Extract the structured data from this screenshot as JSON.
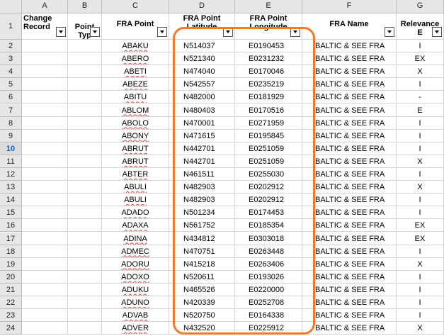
{
  "columns": [
    "A",
    "B",
    "C",
    "D",
    "E",
    "F",
    "G"
  ],
  "header_row_number": "1",
  "headers": [
    {
      "line1": "Change",
      "line2": "Record",
      "align": "left"
    },
    {
      "line1": "Point Typ",
      "line2": "",
      "align": "center"
    },
    {
      "line1": "FRA Point",
      "line2": "",
      "align": "center"
    },
    {
      "line1": "FRA Point",
      "line2": "Latitude",
      "align": "center"
    },
    {
      "line1": "FRA Point",
      "line2": "Longitude",
      "align": "center"
    },
    {
      "line1": "FRA Name",
      "line2": "",
      "align": "center"
    },
    {
      "line1": "Relevance E",
      "line2": "",
      "align": "center"
    }
  ],
  "selected_row": "10",
  "rows": [
    {
      "num": "2",
      "point": "ABAKU",
      "lat": "N514037",
      "lon": "E0190453",
      "name": "BALTIC & SEE FRA",
      "rel": "I"
    },
    {
      "num": "3",
      "point": "ABERO",
      "lat": "N521340",
      "lon": "E0231232",
      "name": "BALTIC & SEE FRA",
      "rel": "EX"
    },
    {
      "num": "4",
      "point": "ABETI",
      "lat": "N474040",
      "lon": "E0170046",
      "name": "BALTIC & SEE FRA",
      "rel": "X"
    },
    {
      "num": "5",
      "point": "ABEZE",
      "lat": "N542557",
      "lon": "E0235219",
      "name": "BALTIC & SEE FRA",
      "rel": "I"
    },
    {
      "num": "6",
      "point": "ABITU",
      "lat": "N482000",
      "lon": "E0181929",
      "name": "BALTIC & SEE FRA",
      "rel": "-"
    },
    {
      "num": "7",
      "point": "ABLOM",
      "lat": "N480403",
      "lon": "E0170516",
      "name": "BALTIC & SEE FRA",
      "rel": "E"
    },
    {
      "num": "8",
      "point": "ABOLO",
      "lat": "N470001",
      "lon": "E0271959",
      "name": "BALTIC & SEE FRA",
      "rel": "I"
    },
    {
      "num": "9",
      "point": "ABONY",
      "lat": "N471615",
      "lon": "E0195845",
      "name": "BALTIC & SEE FRA",
      "rel": "I"
    },
    {
      "num": "10",
      "point": "ABRUT",
      "lat": "N442701",
      "lon": "E0251059",
      "name": "BALTIC & SEE FRA",
      "rel": "I"
    },
    {
      "num": "11",
      "point": "ABRUT",
      "lat": "N442701",
      "lon": "E0251059",
      "name": "BALTIC & SEE FRA",
      "rel": "X"
    },
    {
      "num": "12",
      "point": "ABTER",
      "lat": "N461511",
      "lon": "E0255030",
      "name": "BALTIC & SEE FRA",
      "rel": "I"
    },
    {
      "num": "13",
      "point": "ABULI",
      "lat": "N482903",
      "lon": "E0202912",
      "name": "BALTIC & SEE FRA",
      "rel": "X"
    },
    {
      "num": "14",
      "point": "ABULI",
      "lat": "N482903",
      "lon": "E0202912",
      "name": "BALTIC & SEE FRA",
      "rel": "I"
    },
    {
      "num": "15",
      "point": "ADADO",
      "lat": "N501234",
      "lon": "E0174453",
      "name": "BALTIC & SEE FRA",
      "rel": "I"
    },
    {
      "num": "16",
      "point": "ADAXA",
      "lat": "N561752",
      "lon": "E0185354",
      "name": "BALTIC & SEE FRA",
      "rel": "EX"
    },
    {
      "num": "17",
      "point": "ADINA",
      "lat": "N434812",
      "lon": "E0303018",
      "name": "BALTIC & SEE FRA",
      "rel": "EX"
    },
    {
      "num": "18",
      "point": "ADMEC",
      "lat": "N470751",
      "lon": "E0263448",
      "name": "BALTIC & SEE FRA",
      "rel": "I"
    },
    {
      "num": "19",
      "point": "ADORU",
      "lat": "N415218",
      "lon": "E0263406",
      "name": "BALTIC & SEE FRA",
      "rel": "X"
    },
    {
      "num": "20",
      "point": "ADOXO",
      "lat": "N520611",
      "lon": "E0193026",
      "name": "BALTIC & SEE FRA",
      "rel": "I"
    },
    {
      "num": "21",
      "point": "ADUKU",
      "lat": "N465526",
      "lon": "E0220000",
      "name": "BALTIC & SEE FRA",
      "rel": "I"
    },
    {
      "num": "22",
      "point": "ADUNO",
      "lat": "N420339",
      "lon": "E0252708",
      "name": "BALTIC & SEE FRA",
      "rel": "I"
    },
    {
      "num": "23",
      "point": "ADVAB",
      "lat": "N520750",
      "lon": "E0164338",
      "name": "BALTIC & SEE FRA",
      "rel": "I"
    },
    {
      "num": "24",
      "point": "ADVER",
      "lat": "N432520",
      "lon": "E0225912",
      "name": "BALTIC & SEE FRA",
      "rel": "X"
    }
  ],
  "colors": {
    "highlight": "#f07a2a",
    "selected_row_number": "#1a5fd0",
    "spellcheck": "#e04040"
  }
}
